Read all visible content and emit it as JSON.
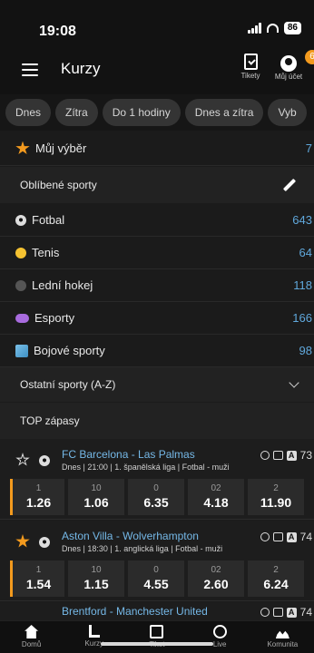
{
  "status_bar": {
    "time": "19:08",
    "battery": "86"
  },
  "header": {
    "title": "Kurzy",
    "tickets_label": "Tikety",
    "account_label": "Můj účet",
    "account_badge": "6"
  },
  "filters": [
    "Dnes",
    "Zítra",
    "Do 1 hodiny",
    "Dnes a zítra",
    "Vyb"
  ],
  "my_selection": {
    "label": "Můj výběr",
    "count": "7"
  },
  "favorites": {
    "title": "Oblíbené sporty",
    "items": [
      {
        "label": "Fotbal",
        "count": "643",
        "icon": "football-icon"
      },
      {
        "label": "Tenis",
        "count": "64",
        "icon": "tennis-icon"
      },
      {
        "label": "Lední hokej",
        "count": "118",
        "icon": "hockey-icon"
      },
      {
        "label": "Esporty",
        "count": "166",
        "icon": "esports-icon"
      },
      {
        "label": "Bojové sporty",
        "count": "98",
        "icon": "combat-sports-icon"
      }
    ]
  },
  "other_sports": {
    "label": "Ostatní sporty (A-Z)"
  },
  "top_matches": {
    "title": "TOP zápasy",
    "matches": [
      {
        "title": "FC Barcelona - Las Palmas",
        "info": "Dnes | 21:00 | 1. španělská liga | Fotbal - muži",
        "more": "73",
        "favorite": false,
        "odds": [
          {
            "label": "1",
            "price": "1.26"
          },
          {
            "label": "10",
            "price": "1.06"
          },
          {
            "label": "0",
            "price": "6.35"
          },
          {
            "label": "02",
            "price": "4.18"
          },
          {
            "label": "2",
            "price": "11.90"
          }
        ]
      },
      {
        "title": "Aston Villa - Wolverhampton",
        "info": "Dnes | 18:30 | 1. anglická liga | Fotbal - muži",
        "more": "74",
        "favorite": true,
        "odds": [
          {
            "label": "1",
            "price": "1.54"
          },
          {
            "label": "10",
            "price": "1.15"
          },
          {
            "label": "0",
            "price": "4.55"
          },
          {
            "label": "02",
            "price": "2.60"
          },
          {
            "label": "2",
            "price": "6.24"
          }
        ]
      },
      {
        "title": "Brentford - Manchester United",
        "more": "74"
      }
    ]
  },
  "bottom_nav": [
    {
      "label": "Domů",
      "icon": "home-icon"
    },
    {
      "label": "Kurzy",
      "icon": "sort-icon"
    },
    {
      "label": "Tiket",
      "icon": "ticket-icon"
    },
    {
      "label": "Live",
      "icon": "live-icon"
    },
    {
      "label": "Komunita",
      "icon": "community-icon"
    }
  ]
}
